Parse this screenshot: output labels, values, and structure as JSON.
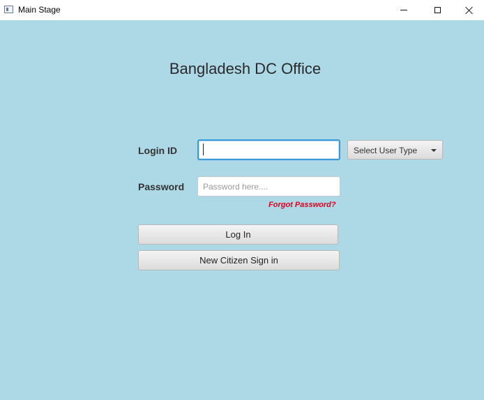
{
  "window": {
    "title": "Main Stage",
    "icon": "app-window-icon",
    "controls": [
      "minimize-icon",
      "maximize-icon",
      "close-icon"
    ]
  },
  "stage": {
    "background": "#add8e6",
    "heading": "Bangladesh DC Office"
  },
  "form": {
    "login_label": "Login ID",
    "login_value": "",
    "password_label": "Password",
    "password_value": "",
    "password_placeholder": "Password here....",
    "user_type_select": "Select User Type",
    "forgot_link": "Forgot Password?",
    "forgot_color": "#e0001b",
    "login_button": "Log In",
    "signup_button": "New Citizen Sign in"
  }
}
